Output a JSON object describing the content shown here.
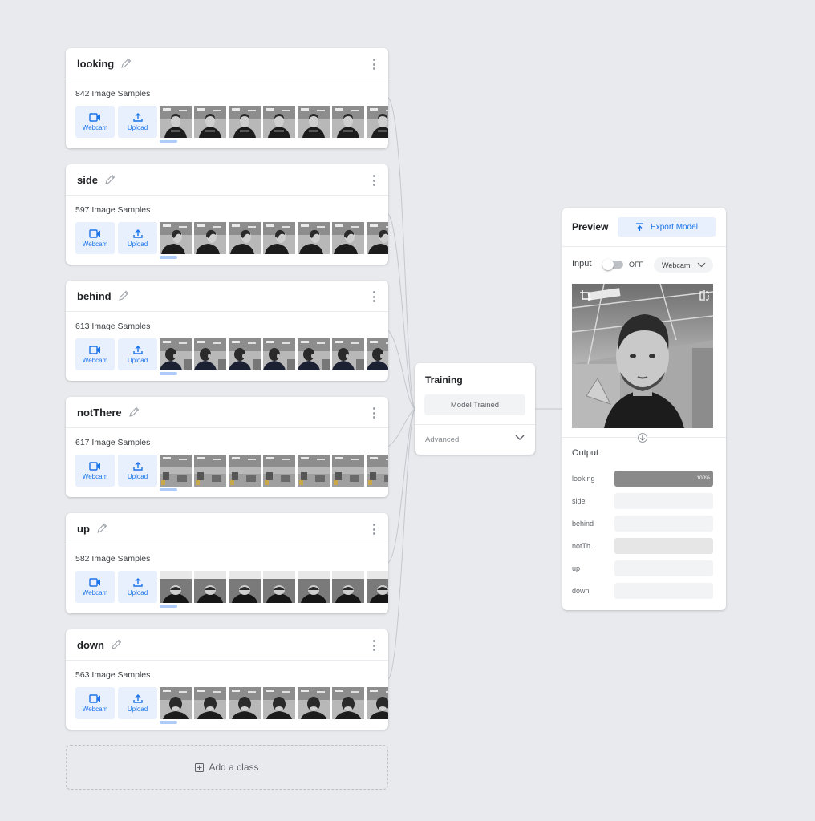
{
  "classes": [
    {
      "name": "looking",
      "count": "842 Image Samples",
      "pose": "front"
    },
    {
      "name": "side",
      "count": "597 Image Samples",
      "pose": "side"
    },
    {
      "name": "behind",
      "count": "613 Image Samples",
      "pose": "behind"
    },
    {
      "name": "notThere",
      "count": "617 Image Samples",
      "pose": "empty"
    },
    {
      "name": "up",
      "count": "582 Image Samples",
      "pose": "up"
    },
    {
      "name": "down",
      "count": "563 Image Samples",
      "pose": "down"
    }
  ],
  "buttons": {
    "webcam": "Webcam",
    "upload": "Upload"
  },
  "add_class": "Add a class",
  "training": {
    "title": "Training",
    "status": "Model Trained",
    "advanced": "Advanced"
  },
  "preview": {
    "title": "Preview",
    "export": "Export Model",
    "input_label": "Input",
    "toggle_state": "OFF",
    "source": "Webcam",
    "output_title": "Output",
    "outputs": [
      {
        "label": "looking",
        "percent": 100,
        "pct_text": "100%"
      },
      {
        "label": "side",
        "percent": 0,
        "pct_text": ""
      },
      {
        "label": "behind",
        "percent": 0,
        "pct_text": ""
      },
      {
        "label": "notTh...",
        "percent": 0,
        "pct_text": ""
      },
      {
        "label": "up",
        "percent": 0,
        "pct_text": ""
      },
      {
        "label": "down",
        "percent": 0,
        "pct_text": ""
      }
    ]
  },
  "colors": {
    "accent": "#1a73e8",
    "accent_light": "#e8f0fe",
    "background": "#e8eaed"
  }
}
